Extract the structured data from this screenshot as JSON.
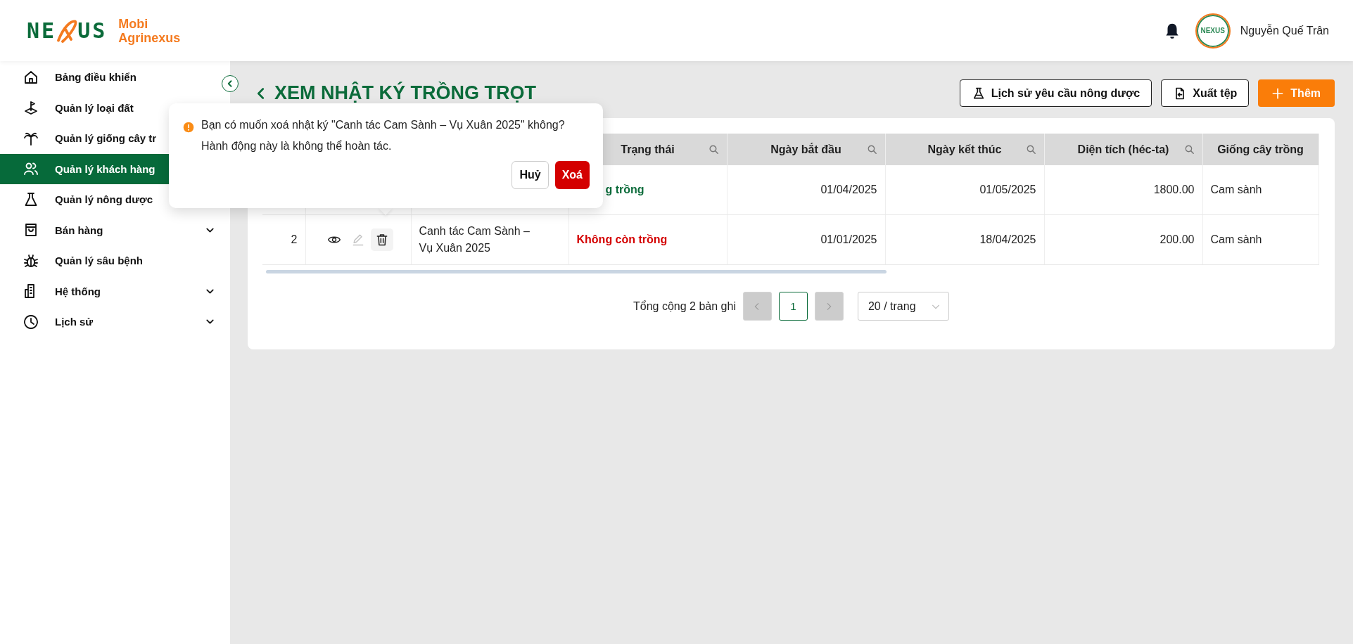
{
  "logo": {
    "mark_parts": [
      "NE",
      "US"
    ],
    "lines": [
      "Mobi",
      "Agrinexus"
    ]
  },
  "header": {
    "user_name": "Nguyễn Quế Trân",
    "avatar_text": "NEXUS"
  },
  "sidebar": {
    "items": [
      {
        "label": "Bảng điều khiển",
        "selected": false,
        "expandable": false
      },
      {
        "label": "Quản lý loại đất",
        "selected": false
      },
      {
        "label": "Quản lý giống cây tr",
        "selected": false
      },
      {
        "label": "Quản lý khách hàng",
        "selected": true
      },
      {
        "label": "Quản lý nông dược",
        "selected": false
      },
      {
        "label": "Bán hàng",
        "selected": false,
        "expandable": true
      },
      {
        "label": "Quản lý sâu bệnh",
        "selected": false,
        "expandable": false
      },
      {
        "label": "Hệ thống",
        "selected": false,
        "expandable": true
      },
      {
        "label": "Lịch sử",
        "selected": false,
        "expandable": true
      }
    ]
  },
  "page": {
    "title": "XEM NHẬT KÝ TRỒNG TRỌT",
    "buttons": [
      {
        "label": "Lịch sử yêu cầu nông dược",
        "kind": "outline"
      },
      {
        "label": "Xuất tệp",
        "kind": "outline"
      },
      {
        "label": "Thêm",
        "kind": "primary"
      }
    ]
  },
  "table": {
    "columns": [
      "Trạng thái",
      "Ngày bắt đầu",
      "Ngày kết thúc",
      "Diện tích (héc-ta)",
      "Giống cây trồng"
    ],
    "rows": [
      {
        "status": "g trồng",
        "color": "#0b6b3a",
        "start": "01/04/2025",
        "end": "01/05/2025",
        "area": "1800.00",
        "variety": "Cam sành"
      },
      {
        "index": "2",
        "actions": [
          {
            "kind": "view",
            "disabled": false,
            "selected": false
          },
          {
            "kind": "edit",
            "disabled": true,
            "selected": false
          },
          {
            "kind": "delete",
            "disabled": false,
            "selected": true
          }
        ],
        "name": "Canh tác Cam Sành – Vụ Xuân 2025",
        "status": "Không còn trồng",
        "color": "#d40000",
        "start": "01/01/2025",
        "end": "18/04/2025",
        "area": "200.00",
        "variety": "Cam sành"
      }
    ]
  },
  "pagination": {
    "summary": "Tổng cộng 2 bản ghi",
    "prev_disabled": true,
    "next_disabled": true,
    "pages": [
      {
        "label": "1",
        "selected": true
      }
    ],
    "page_size": "20 / trang"
  },
  "popover": {
    "message": "Bạn có muốn xoá nhật ký \"Canh tác Cam Sành – Vụ Xuân 2025\" không?\nHành động này là không thể hoàn tác.",
    "buttons": [
      {
        "label": "Huỷ",
        "kind": "cancel"
      },
      {
        "label": "Xoá",
        "kind": "danger"
      }
    ]
  }
}
